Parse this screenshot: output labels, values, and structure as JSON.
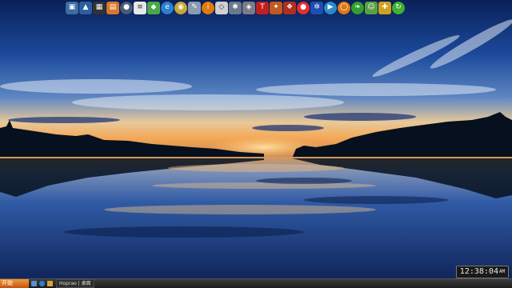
{
  "dock": {
    "items": [
      {
        "name": "network-icon",
        "glyph": "▣",
        "bg": "#3a6ea5"
      },
      {
        "name": "photo-viewer-icon",
        "glyph": "▲",
        "bg": "#2b5fa0"
      },
      {
        "name": "media-player-icon",
        "glyph": "▦",
        "bg": "#333333"
      },
      {
        "name": "file-manager-icon",
        "glyph": "▤",
        "bg": "#d8782a"
      },
      {
        "name": "control-panel-icon",
        "glyph": "●",
        "bg": "#4a5a7a"
      },
      {
        "name": "notepad-icon",
        "glyph": "≡",
        "bg": "#e8e8e8"
      },
      {
        "name": "green-shield-icon",
        "glyph": "◆",
        "bg": "#4aa84a"
      },
      {
        "name": "browser-icon",
        "glyph": "e",
        "bg": "#2d7fd3"
      },
      {
        "name": "disc-icon",
        "glyph": "◉",
        "bg": "#c8a63a"
      },
      {
        "name": "tool-icon",
        "glyph": "✎",
        "bg": "#8a9ab0"
      },
      {
        "name": "info-icon",
        "glyph": "i",
        "bg": "#e07a10"
      },
      {
        "name": "clipboard-icon",
        "glyph": "◇",
        "bg": "#d0d0d0"
      },
      {
        "name": "settings-icon",
        "glyph": "✱",
        "bg": "#6a7890"
      },
      {
        "name": "layers-icon",
        "glyph": "◈",
        "bg": "#7a7a8a"
      },
      {
        "name": "text-tool-icon",
        "glyph": "T",
        "bg": "#c02020"
      },
      {
        "name": "compass-icon",
        "glyph": "✦",
        "bg": "#c05a20"
      },
      {
        "name": "fox-icon",
        "glyph": "❖",
        "bg": "#b03020"
      },
      {
        "name": "record-icon",
        "glyph": "●",
        "bg": "#e03030"
      },
      {
        "name": "bluetooth-icon",
        "glyph": "✲",
        "bg": "#1e4fb0"
      },
      {
        "name": "play-icon",
        "glyph": "▶",
        "bg": "#2a8ad0"
      },
      {
        "name": "basketball-icon",
        "glyph": "◯",
        "bg": "#e07818"
      },
      {
        "name": "leaf-icon",
        "glyph": "❧",
        "bg": "#30a030"
      },
      {
        "name": "users-icon",
        "glyph": "☺",
        "bg": "#58a040"
      },
      {
        "name": "game-icon",
        "glyph": "✚",
        "bg": "#d0a020"
      },
      {
        "name": "refresh-icon",
        "glyph": "↻",
        "bg": "#40b030"
      }
    ]
  },
  "clock": {
    "time": "12:38:04",
    "ampm": "AM"
  },
  "watermark": "#769042",
  "taskbar": {
    "start_label": "开始",
    "task_label": "Hoprao | 桌面"
  },
  "colors": {
    "sky_top": "#0b2560",
    "sky_mid": "#3f6fb8",
    "horizon": "#f2b36a",
    "water": "#1b3d86"
  }
}
